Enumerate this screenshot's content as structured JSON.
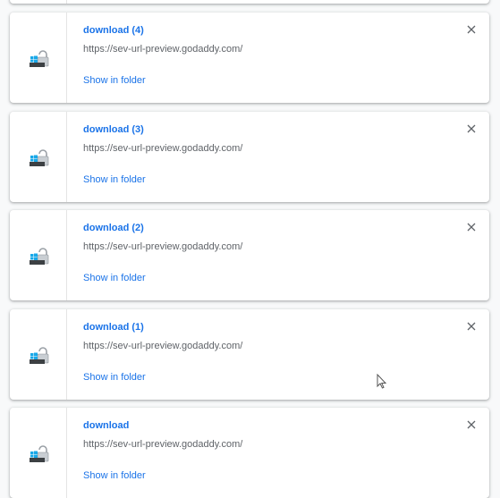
{
  "colors": {
    "link": "#1a73e8",
    "text": "#5f6368",
    "background": "#f8f9fa"
  },
  "downloads": [
    {
      "title": "download (4)",
      "url": "https://sev-url-preview.godaddy.com/",
      "action": "Show in folder",
      "icon": "installer-file-icon"
    },
    {
      "title": "download (3)",
      "url": "https://sev-url-preview.godaddy.com/",
      "action": "Show in folder",
      "icon": "installer-file-icon"
    },
    {
      "title": "download (2)",
      "url": "https://sev-url-preview.godaddy.com/",
      "action": "Show in folder",
      "icon": "installer-file-icon"
    },
    {
      "title": "download (1)",
      "url": "https://sev-url-preview.godaddy.com/",
      "action": "Show in folder",
      "icon": "installer-file-icon"
    },
    {
      "title": "download",
      "url": "https://sev-url-preview.godaddy.com/",
      "action": "Show in folder",
      "icon": "installer-file-icon"
    }
  ]
}
